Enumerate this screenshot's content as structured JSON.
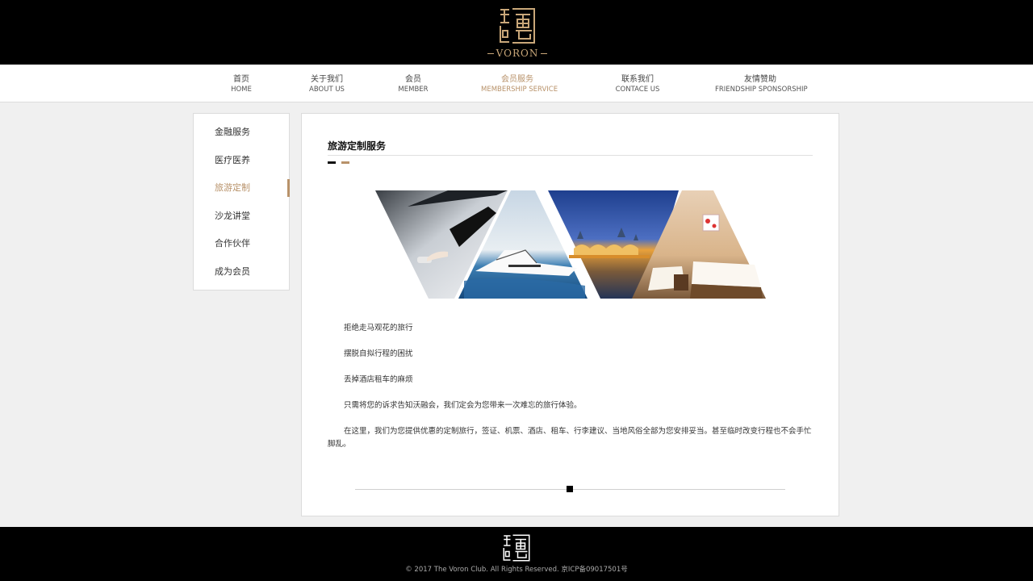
{
  "header": {
    "logo_text": "VORON",
    "brand_color": "#c9a779"
  },
  "nav": {
    "items": [
      {
        "cn": "首页",
        "en": "HOME"
      },
      {
        "cn": "关于我们",
        "en": "ABOUT US"
      },
      {
        "cn": "会员",
        "en": "MEMBER"
      },
      {
        "cn": "会员服务",
        "en": "MEMBERSHIP SERVICE"
      },
      {
        "cn": "联系我们",
        "en": "CONTACE US"
      },
      {
        "cn": "友情赞助",
        "en": "FRIENDSHIP SPONSORSHIP"
      }
    ],
    "active_index": 3,
    "accent_color": "#b8926a"
  },
  "sidebar": {
    "items": [
      {
        "label": "金融服务"
      },
      {
        "label": "医疗医养"
      },
      {
        "label": "旅游定制"
      },
      {
        "label": "沙龙讲堂"
      },
      {
        "label": "合作伙伴"
      },
      {
        "label": "成为会员"
      }
    ],
    "active_index": 2
  },
  "main": {
    "title": "旅游定制服务",
    "banner_icons": [
      "car-door-icon",
      "yacht-icon",
      "night-city-icon",
      "hotel-room-icon"
    ],
    "paragraphs": [
      "拒绝走马观花的旅行",
      "摆脱自拟行程的困扰",
      "丢掉酒店租车的麻烦",
      "只需将您的诉求告知沃融会，我们定会为您带来一次难忘的旅行体验。",
      "在这里，我们为您提供优惠的定制旅行，签证、机票、酒店、租车、行李建议、当地风俗全部为您安排妥当。甚至临时改变行程也不会手忙脚乱。"
    ]
  },
  "footer": {
    "copyright": "© 2017 The Voron Club. All Rights Reserved. 京ICP备09017501号"
  }
}
